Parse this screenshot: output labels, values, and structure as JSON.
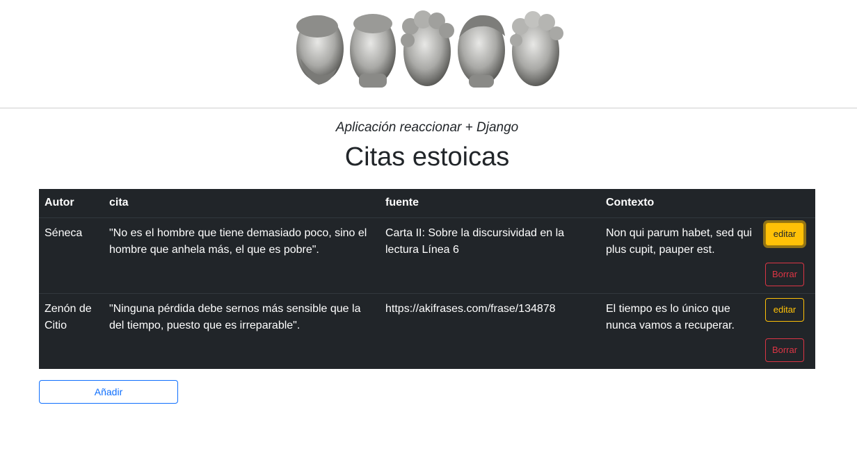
{
  "header": {
    "logo_alt": "stoic busts"
  },
  "subtitle": "Aplicación reaccionar + Django",
  "title": "Citas estoicas",
  "table": {
    "columns": [
      "Autor",
      "cita",
      "fuente",
      "Contexto"
    ],
    "rows": [
      {
        "autor": "Séneca",
        "cita": "\"No es el hombre que tiene demasiado poco, sino el hombre que anhela más, el que es pobre\".",
        "fuente": "Carta II: Sobre la discursividad en la lectura Línea 6",
        "contexto": "Non qui parum habet, sed qui plus cupit, pauper est.",
        "edit_label": "editar",
        "delete_label": "Borrar"
      },
      {
        "autor": "Zenón de Citio",
        "cita": "\"Ninguna pérdida debe sernos más sensible que la del tiempo, puesto que es irreparable\".",
        "fuente": "https://akifrases.com/frase/134878",
        "contexto": "El tiempo es lo único que nunca vamos a recuperar.",
        "edit_label": "editar",
        "delete_label": "Borrar"
      }
    ]
  },
  "add_label": "Añadir",
  "colors": {
    "table_bg": "#212529",
    "edit": "#ffc107",
    "delete": "#dc3545",
    "primary": "#0d6efd"
  }
}
